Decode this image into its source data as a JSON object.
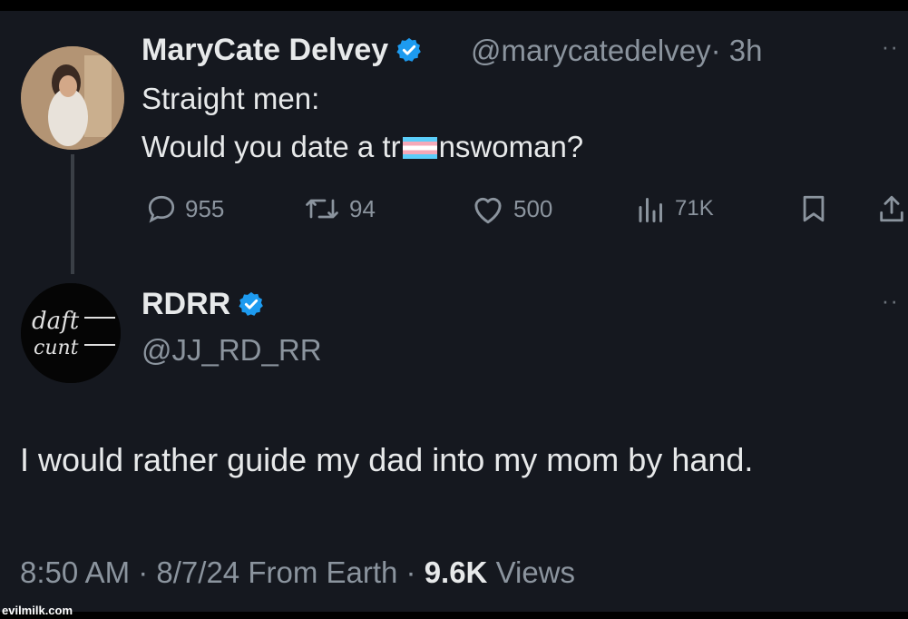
{
  "tweet1": {
    "name": "MaryCate Delvey",
    "handle": "@marycatedelvey",
    "time": "· 3h",
    "line1": "Straight men:",
    "line2_a": "Would you date a tr",
    "line2_b": "nswoman?",
    "actions": {
      "replies": "955",
      "reposts": "94",
      "likes": "500",
      "views": "71K"
    }
  },
  "tweet2": {
    "name": "RDRR",
    "handle": "@JJ_RD_RR",
    "avatar_text_1": "daft",
    "avatar_text_2": "cunt",
    "text": "I would rather guide my dad into my mom by hand.",
    "timestamp": "8:50 AM · 8/7/24 From Earth · ",
    "views_count": "9.6K",
    "views_label": " Views"
  },
  "watermark": "evilmilk.com",
  "colors": {
    "background": "#15181f",
    "text": "#e7e9ea",
    "secondary": "#8b949e",
    "verified": "#1d9bf0"
  }
}
